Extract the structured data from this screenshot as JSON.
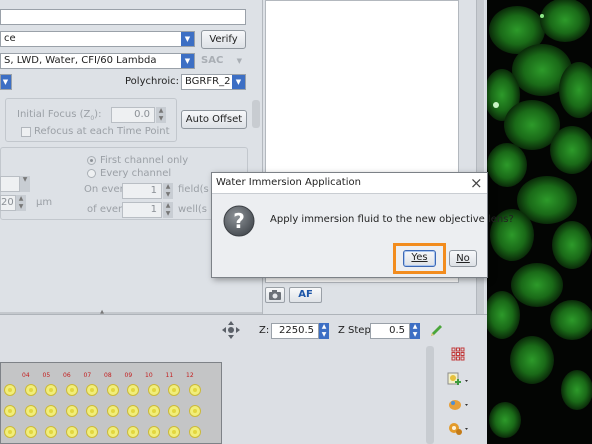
{
  "left_panel": {
    "row1_text": "",
    "row2_value": "ce",
    "verify_label": "Verify",
    "objective_value": "S, LWD, Water, CFI/60 Lambda",
    "sac_label": "SAC",
    "polychroic_label": "Polychroic:",
    "polychroic_value": "BGRFR_2",
    "initial_focus_label": "Initial Focus (Z",
    "initial_focus_sub": "0",
    "initial_focus_suffix": "):",
    "initial_focus_value": "0.0",
    "refocus_label": "Refocus at each Time Point",
    "auto_offset_label": "Auto Offset",
    "first_channel_label": "First channel only",
    "every_channel_label": "Every channel",
    "on_every_label": "On every",
    "on_every_value": "1",
    "fields_label": "field(s",
    "of_every_label": "of every",
    "of_every_value": "1",
    "wells_label": "well(s",
    "um_value": "20",
    "um_label": "μm"
  },
  "preview": {
    "af_label": "AF"
  },
  "zbar": {
    "z_label": "Z:",
    "z_value": "2250.5",
    "zstep_label": "Z Step:",
    "zstep_value": "0.5"
  },
  "plate": {
    "columns": [
      "04",
      "05",
      "06",
      "07",
      "08",
      "09",
      "10",
      "11",
      "12"
    ]
  },
  "dialog": {
    "title": "Water Immersion Application",
    "close": "×",
    "message": "Apply immersion fluid to the new objective lens?",
    "yes_label": "Yes",
    "no_label": "No",
    "highlight_color": "#f28c1e"
  }
}
